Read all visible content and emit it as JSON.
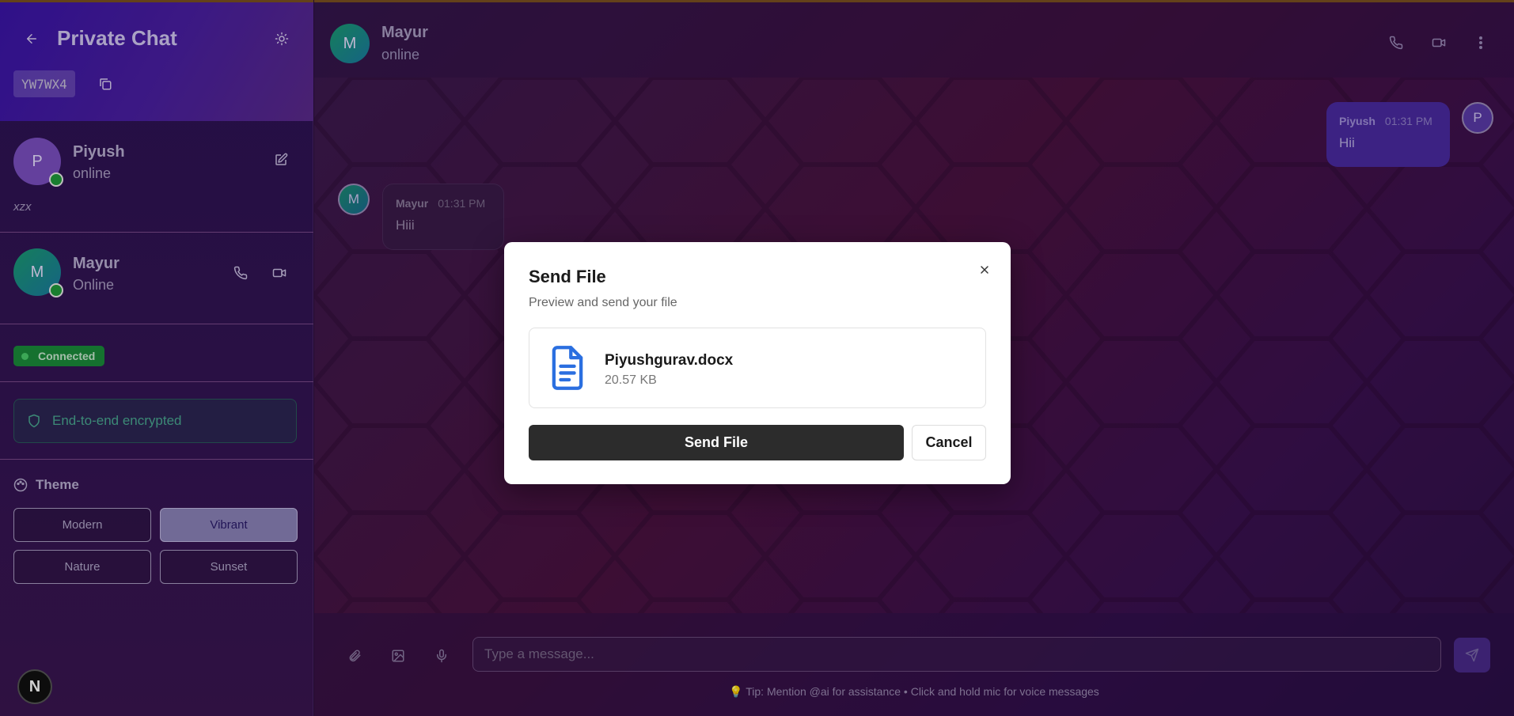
{
  "sidebar": {
    "title": "Private Chat",
    "room_code": "YW7WX4",
    "me": {
      "initial": "P",
      "name": "Piyush",
      "status": "online",
      "bio": "xzx"
    },
    "peer": {
      "initial": "M",
      "name": "Mayur",
      "status": "Online"
    },
    "connection_status": "Connected",
    "encryption_label": "End-to-end encrypted",
    "theme_heading": "Theme",
    "themes": [
      "Modern",
      "Vibrant",
      "Nature",
      "Sunset"
    ],
    "active_theme": "Vibrant",
    "badge": "N"
  },
  "chat": {
    "header": {
      "initial": "M",
      "name": "Mayur",
      "status": "online"
    },
    "messages": [
      {
        "sender": "Piyush",
        "initial": "P",
        "time": "01:31 PM",
        "text": "Hii",
        "direction": "outgoing"
      },
      {
        "sender": "Mayur",
        "initial": "M",
        "time": "01:31 PM",
        "text": "Hiii",
        "direction": "incoming"
      }
    ],
    "input_placeholder": "Type a message...",
    "tip": "Tip: Mention @ai for assistance • Click and hold mic for voice messages"
  },
  "modal": {
    "title": "Send File",
    "subtitle": "Preview and send your file",
    "file_name": "Piyushgurav.docx",
    "file_size": "20.57 KB",
    "send_label": "Send File",
    "cancel_label": "Cancel"
  },
  "colors": {
    "accent_purple": "#4a2aa0",
    "online_green": "#1f9a3a",
    "file_icon_blue": "#2b6fe0"
  }
}
